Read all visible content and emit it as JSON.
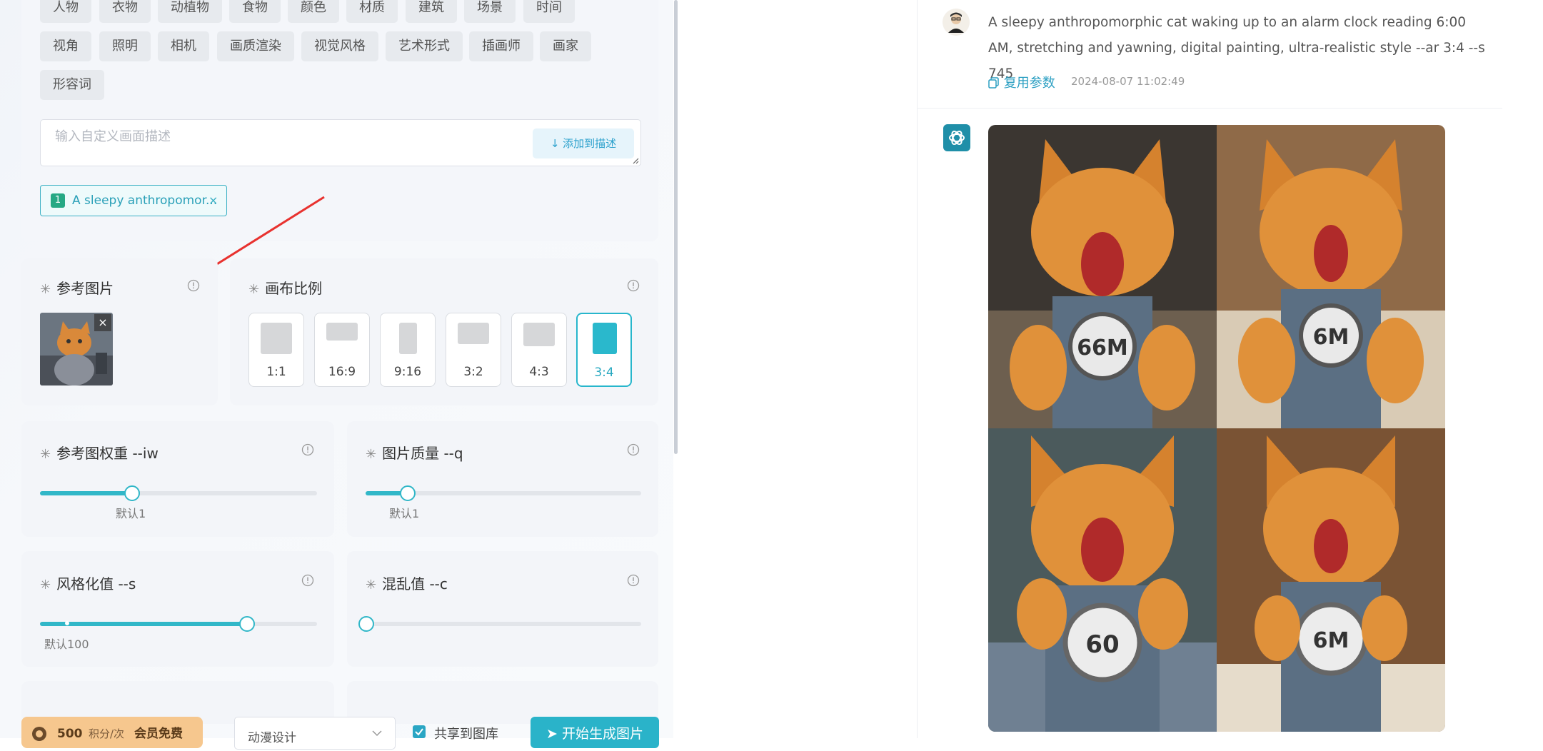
{
  "colors": {
    "accent": "#2ab3c9",
    "link": "#2b9fc2",
    "chip_badge": "#26a884",
    "credits_bg": "#f6c78e"
  },
  "tags": [
    "人物",
    "衣物",
    "动植物",
    "食物",
    "颜色",
    "材质",
    "建筑",
    "场景",
    "时间",
    "视角",
    "照明",
    "相机",
    "画质渲染",
    "视觉风格",
    "艺术形式",
    "插画师",
    "画家",
    "形容词"
  ],
  "description": {
    "placeholder": "输入自定义画面描述",
    "add_button": "添加到描述",
    "chip_index": "1",
    "chip_text": "A sleepy anthropomor..."
  },
  "reference_image": {
    "title": "参考图片",
    "remove": "×"
  },
  "canvas_ratio": {
    "title": "画布比例",
    "options": [
      "1:1",
      "16:9",
      "9:16",
      "3:2",
      "4:3",
      "3:4"
    ],
    "selected": "3:4"
  },
  "sliders": {
    "iw": {
      "title": "参考图权重 --iw",
      "default_label": "默认1",
      "level": 0.33
    },
    "q": {
      "title": "图片质量 --q",
      "default_label": "默认1",
      "level": 0.15
    },
    "s": {
      "title": "风格化值 --s",
      "default_label": "默认100",
      "level": 0.745
    },
    "c": {
      "title": "混乱值 --c",
      "level": 0.0
    }
  },
  "bottom_bar": {
    "credits_value": "500",
    "credits_unit": "积分/次",
    "member_free": "会员免费",
    "style_select": "动漫设计",
    "share_label": "共享到图库",
    "share_checked": true,
    "generate_button": "开始生成图片"
  },
  "message": {
    "prompt": "A sleepy anthropomorphic cat waking up to an alarm clock reading 6:00 AM, stretching and yawning, digital painting, ultra-realistic style --ar 3:4 --s 745",
    "reuse": "复用参数",
    "time": "2024-08-07 11:02:49"
  },
  "results": {
    "clock_labels": [
      "66M",
      "6M",
      "60",
      "6M"
    ]
  }
}
